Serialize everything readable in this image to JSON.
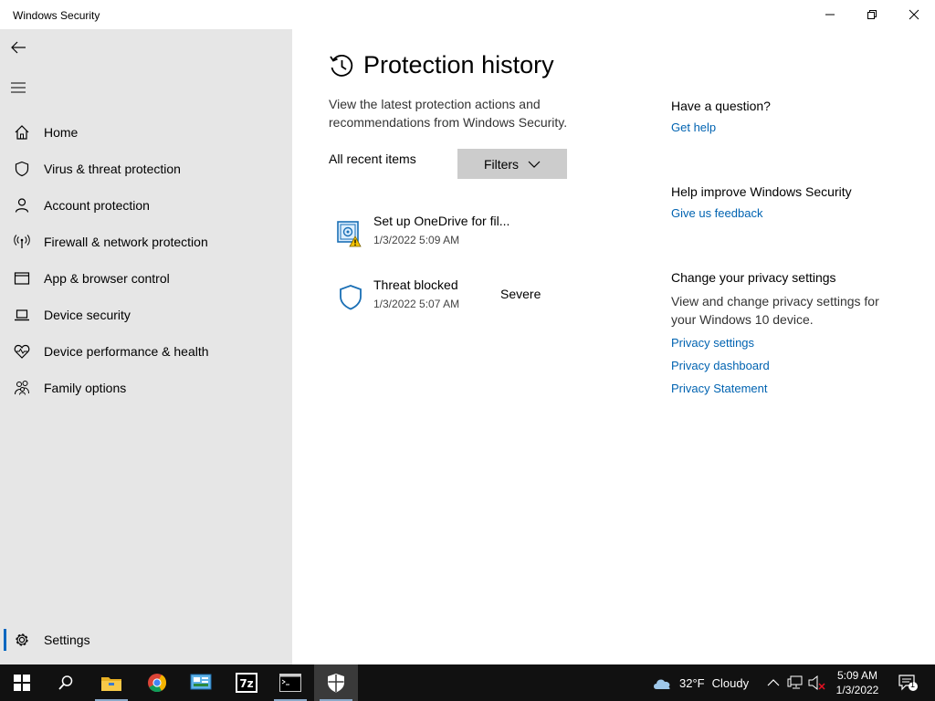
{
  "window": {
    "title": "Windows Security"
  },
  "sidebar": {
    "items": [
      {
        "label": "Home",
        "icon": "home-icon"
      },
      {
        "label": "Virus & threat protection",
        "icon": "shield-icon"
      },
      {
        "label": "Account protection",
        "icon": "person-icon"
      },
      {
        "label": "Firewall & network protection",
        "icon": "antenna-icon"
      },
      {
        "label": "App & browser control",
        "icon": "browser-window-icon"
      },
      {
        "label": "Device security",
        "icon": "laptop-icon"
      },
      {
        "label": "Device performance & health",
        "icon": "heart-pulse-icon"
      },
      {
        "label": "Family options",
        "icon": "family-icon"
      }
    ],
    "settings_label": "Settings"
  },
  "main": {
    "title": "Protection history",
    "description": "View the latest protection actions and recommendations from Windows Security.",
    "filter_label": "All recent items",
    "filters_button": "Filters",
    "history": [
      {
        "title": "Set up OneDrive for fil...",
        "date": "1/3/2022 5:09 AM",
        "severity": "",
        "icon": "onedrive-warning-icon"
      },
      {
        "title": "Threat blocked",
        "date": "1/3/2022 5:07 AM",
        "severity": "Severe",
        "icon": "shield-outline-icon"
      }
    ]
  },
  "side": {
    "question": {
      "heading": "Have a question?",
      "link": "Get help"
    },
    "improve": {
      "heading": "Help improve Windows Security",
      "link": "Give us feedback"
    },
    "privacy": {
      "heading": "Change your privacy settings",
      "text": "View and change privacy settings for your Windows 10 device.",
      "links": [
        "Privacy settings",
        "Privacy dashboard",
        "Privacy Statement"
      ]
    }
  },
  "taskbar": {
    "weather": {
      "temp": "32°F",
      "condition": "Cloudy"
    },
    "clock": {
      "time": "5:09 AM",
      "date": "1/3/2022"
    },
    "notifications": "1"
  },
  "colors": {
    "accent": "#0067c0",
    "link": "#0063b1",
    "sidebar": "#e6e6e6",
    "taskbar": "#111111"
  }
}
